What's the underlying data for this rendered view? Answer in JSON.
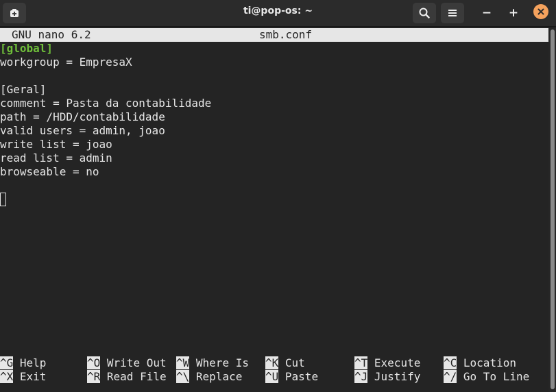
{
  "window": {
    "title": "ti@pop-os: ~"
  },
  "titlebar": {
    "icons": {
      "new_tab": "new-tab-icon",
      "search": "search-icon",
      "menu": "hamburger-menu-icon",
      "minimize": "minimize-icon",
      "maximize": "maximize-icon",
      "close": "close-icon"
    },
    "minimize_glyph": "−",
    "maximize_glyph": "+",
    "close_glyph": "✕",
    "close_color": "#f5a25d"
  },
  "nano": {
    "version": "GNU nano 6.2",
    "filename": "smb.conf",
    "lines": [
      "[global]",
      "workgroup = EmpresaX",
      "",
      "[Geral]",
      "comment = Pasta da contabilidade",
      "path = /HDD/contabilidade",
      "valid users = admin, joao",
      "write list = joao",
      "read list = admin",
      "browseable = no"
    ],
    "shortcuts_row1": [
      {
        "key": "^G",
        "label": "Help"
      },
      {
        "key": "^O",
        "label": "Write Out"
      },
      {
        "key": "^W",
        "label": "Where Is"
      },
      {
        "key": "^K",
        "label": "Cut"
      },
      {
        "key": "^T",
        "label": "Execute"
      },
      {
        "key": "^C",
        "label": "Location"
      }
    ],
    "shortcuts_row2": [
      {
        "key": "^X",
        "label": "Exit"
      },
      {
        "key": "^R",
        "label": "Read File"
      },
      {
        "key": "^\\",
        "label": "Replace"
      },
      {
        "key": "^U",
        "label": "Paste"
      },
      {
        "key": "^J",
        "label": "Justify"
      },
      {
        "key": "^/",
        "label": "Go To Line"
      }
    ]
  },
  "colors": {
    "section_global": "#6fbf3a",
    "header_bg": "#e6e6e6",
    "terminal_bg": "#242424"
  }
}
